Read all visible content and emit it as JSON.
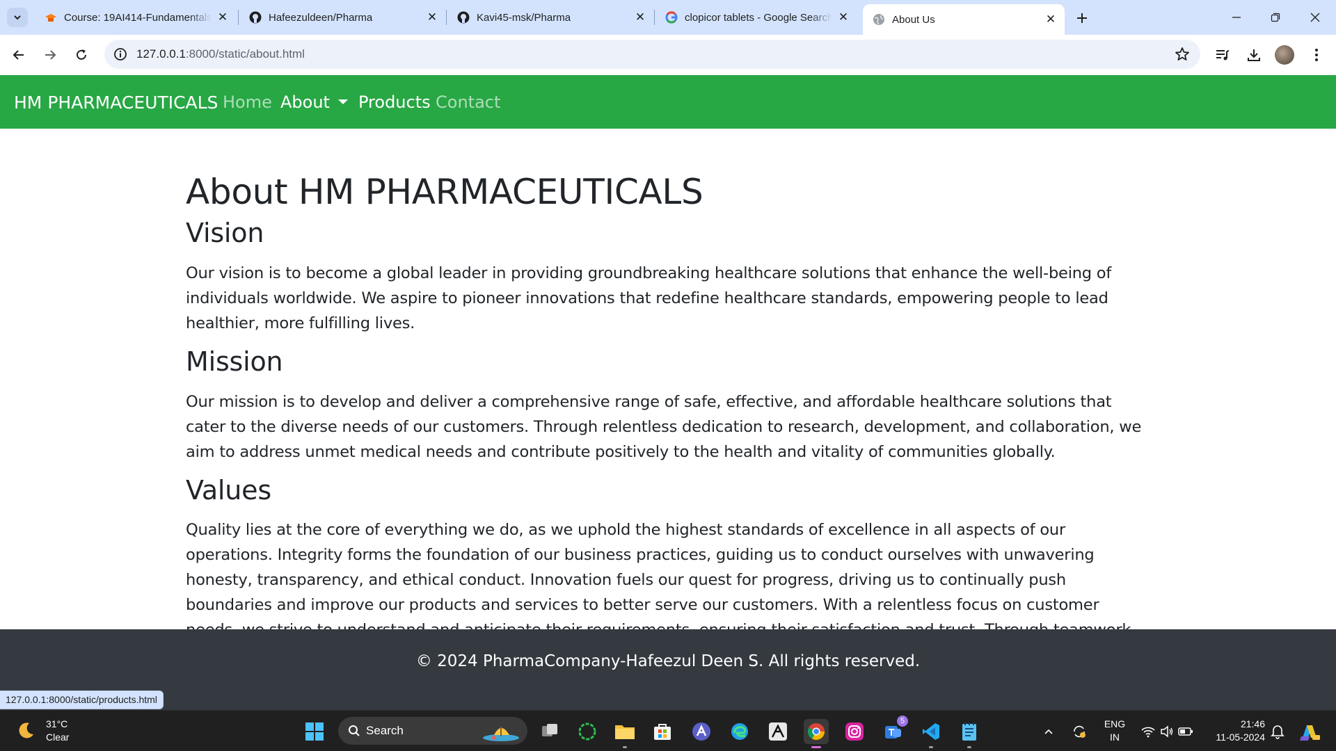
{
  "browser": {
    "tabs": [
      {
        "title": "Course: 19AI414-Fundamentals",
        "icon": "moodle-icon",
        "active": false
      },
      {
        "title": "Hafeezuldeen/Pharma",
        "icon": "github-icon",
        "active": false
      },
      {
        "title": "Kavi45-msk/Pharma",
        "icon": "github-icon",
        "active": false
      },
      {
        "title": "clopicor tablets - Google Search",
        "icon": "google-icon",
        "active": false
      },
      {
        "title": "About Us",
        "icon": "globe-icon",
        "active": true
      }
    ],
    "url_host": "127.0.0.1",
    "url_rest": ":8000/static/about.html",
    "status_url": "127.0.0.1:8000/static/products.html"
  },
  "site": {
    "brand": "HM PHARMACEUTICALS",
    "nav": {
      "home": "Home",
      "about": "About",
      "products": "Products",
      "contact": "Contact"
    },
    "page_title": "About HM PHARMACEUTICALS",
    "sections": {
      "vision": {
        "heading": "Vision",
        "text": "Our vision is to become a global leader in providing groundbreaking healthcare solutions that enhance the well-being of individuals worldwide. We aspire to pioneer innovations that redefine healthcare standards, empowering people to lead healthier, more fulfilling lives."
      },
      "mission": {
        "heading": "Mission",
        "text": "Our mission is to develop and deliver a comprehensive range of safe, effective, and affordable healthcare solutions that cater to the diverse needs of our customers. Through relentless dedication to research, development, and collaboration, we aim to address unmet medical needs and contribute positively to the health and vitality of communities globally."
      },
      "values": {
        "heading": "Values",
        "text": "Quality lies at the core of everything we do, as we uphold the highest standards of excellence in all aspects of our operations. Integrity forms the foundation of our business practices, guiding us to conduct ourselves with unwavering honesty, transparency, and ethical conduct. Innovation fuels our quest for progress, driving us to continually push boundaries and improve our products and services to better serve our customers. With a relentless focus on customer needs, we strive to understand and anticipate their requirements, ensuring their satisfaction and trust. Through teamwork and collaboration, we harness the collective talents and"
      }
    },
    "footer": "© 2024 PharmaCompany-Hafeezul Deen S. All rights reserved.",
    "colors": {
      "navbar": "#28a745",
      "footer": "#343a40",
      "text": "#212529"
    }
  },
  "taskbar": {
    "weather_temp": "31°C",
    "weather_desc": "Clear",
    "search_label": "Search",
    "lang_top": "ENG",
    "lang_bottom": "IN",
    "time": "21:46",
    "date": "11-05-2024",
    "teams_badge": "5"
  }
}
